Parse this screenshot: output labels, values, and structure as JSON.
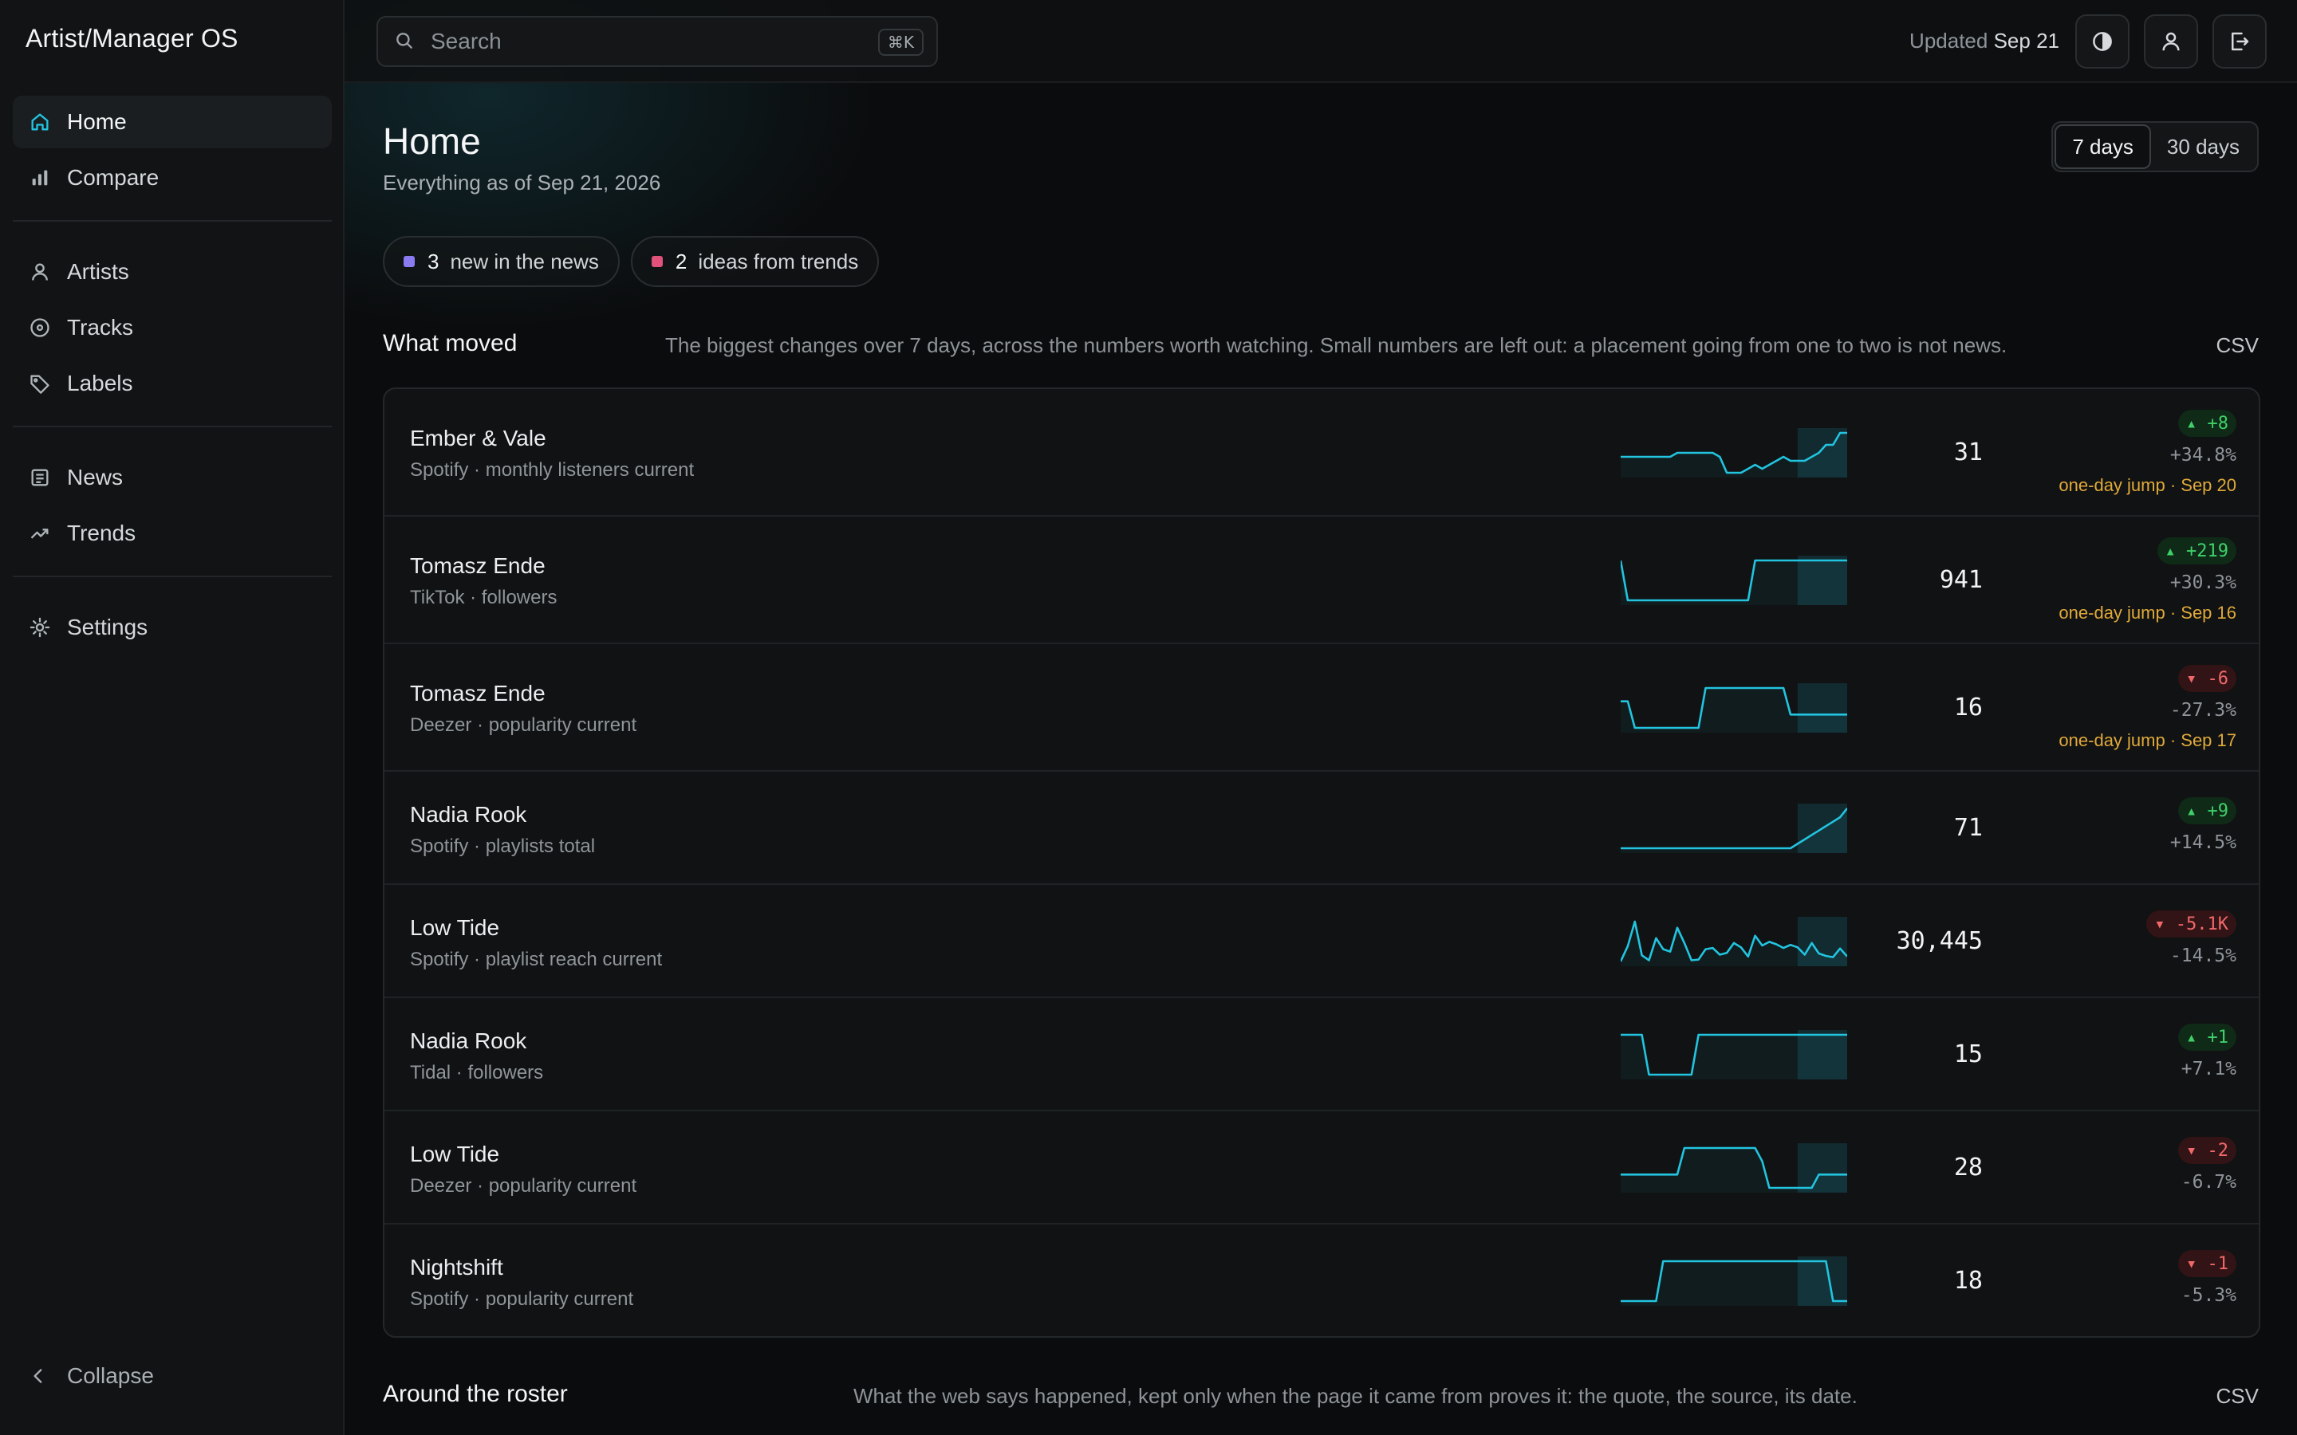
{
  "app": {
    "title": "Artist/Manager OS"
  },
  "sidebar": {
    "items": [
      {
        "label": "Home",
        "icon": "home-icon",
        "active": true
      },
      {
        "label": "Compare",
        "icon": "bar-chart-icon"
      },
      {
        "label": "Artists",
        "icon": "user-icon"
      },
      {
        "label": "Tracks",
        "icon": "disc-icon"
      },
      {
        "label": "Labels",
        "icon": "tag-icon"
      },
      {
        "label": "News",
        "icon": "newspaper-icon"
      },
      {
        "label": "Trends",
        "icon": "trending-up-icon"
      },
      {
        "label": "Settings",
        "icon": "gear-icon"
      }
    ],
    "collapse_label": "Collapse"
  },
  "topbar": {
    "search_placeholder": "Search",
    "search_shortcut": "⌘K",
    "updated_prefix": "Updated",
    "updated_date": "Sep 21"
  },
  "page": {
    "title": "Home",
    "subtitle": "Everything as of Sep 21, 2026",
    "range_options": [
      "7 days",
      "30 days"
    ],
    "range_selected": "7 days",
    "chips": [
      {
        "count": "3",
        "label": "new in the news",
        "color": "#8a7cf0"
      },
      {
        "count": "2",
        "label": "ideas from trends",
        "color": "#e0527a"
      }
    ]
  },
  "what_moved": {
    "title": "What moved",
    "description": "The biggest changes over 7 days, across the numbers worth watching. Small numbers are left out: a placement going from one to two is not news.",
    "csv_label": "CSV",
    "rows": [
      {
        "name": "Ember & Vale",
        "meta": "Spotify · monthly listeners current",
        "value": "31",
        "delta": "▴ +8",
        "direction": "up",
        "pct": "+34.8%",
        "jump": "one-day jump · Sep 20",
        "spark": [
          20,
          20,
          20,
          20,
          20,
          20,
          20,
          20,
          21,
          21,
          21,
          21,
          21,
          21,
          20,
          16,
          16,
          16,
          17,
          18,
          17,
          18,
          19,
          20,
          19,
          19,
          19,
          20,
          21,
          23,
          23,
          26,
          26
        ]
      },
      {
        "name": "Tomasz Ende",
        "meta": "TikTok · followers",
        "value": "941",
        "delta": "▴ +219",
        "direction": "up",
        "pct": "+30.3%",
        "jump": "one-day jump · Sep 16",
        "spark": [
          940,
          722,
          722,
          722,
          722,
          722,
          722,
          722,
          722,
          722,
          722,
          722,
          722,
          722,
          722,
          722,
          722,
          722,
          722,
          941,
          941,
          941,
          941,
          941,
          941,
          941,
          941,
          941,
          941,
          941,
          941,
          941,
          941
        ]
      },
      {
        "name": "Tomasz Ende",
        "meta": "Deezer · popularity current",
        "value": "16",
        "delta": "▾ -6",
        "direction": "down",
        "pct": "-27.3%",
        "jump": "one-day jump · Sep 17",
        "spark": [
          20,
          20,
          16,
          16,
          16,
          16,
          16,
          16,
          16,
          16,
          16,
          16,
          22,
          22,
          22,
          22,
          22,
          22,
          22,
          22,
          22,
          22,
          22,
          22,
          18,
          18,
          18,
          18,
          18,
          18,
          18,
          18,
          18
        ]
      },
      {
        "name": "Nadia Rook",
        "meta": "Spotify · playlists total",
        "value": "71",
        "delta": "▴ +9",
        "direction": "up",
        "pct": "+14.5%",
        "jump": "",
        "spark": [
          62,
          62,
          62,
          62,
          62,
          62,
          62,
          62,
          62,
          62,
          62,
          62,
          62,
          62,
          62,
          62,
          62,
          62,
          62,
          62,
          62,
          62,
          62,
          62,
          62,
          63,
          64,
          65,
          66,
          67,
          68,
          69,
          71
        ]
      },
      {
        "name": "Low Tide",
        "meta": "Spotify · playlist reach current",
        "value": "30,445",
        "delta": "▾ -5.1K",
        "direction": "down",
        "pct": "-14.5%",
        "jump": "",
        "spark": [
          31000,
          33500,
          37500,
          32000,
          31200,
          34800,
          33000,
          32600,
          36500,
          34000,
          31200,
          31300,
          33000,
          33200,
          32100,
          32400,
          34000,
          33300,
          31800,
          35200,
          33600,
          34200,
          33800,
          33200,
          33700,
          33300,
          32100,
          34000,
          32300,
          31900,
          31700,
          33100,
          31800
        ]
      },
      {
        "name": "Nadia Rook",
        "meta": "Tidal · followers",
        "value": "15",
        "delta": "▴ +1",
        "direction": "up",
        "pct": "+7.1%",
        "jump": "",
        "spark": [
          15,
          15,
          15,
          15,
          14,
          14,
          14,
          14,
          14,
          14,
          14,
          15,
          15,
          15,
          15,
          15,
          15,
          15,
          15,
          15,
          15,
          15,
          15,
          15,
          15,
          15,
          15,
          15,
          15,
          15,
          15,
          15,
          15
        ]
      },
      {
        "name": "Low Tide",
        "meta": "Deezer · popularity current",
        "value": "28",
        "delta": "▾ -2",
        "direction": "down",
        "pct": "-6.7%",
        "jump": "",
        "spark": [
          28,
          28,
          28,
          28,
          28,
          28,
          28,
          28,
          28,
          30,
          30,
          30,
          30,
          30,
          30,
          30,
          30,
          30,
          30,
          30,
          29,
          27,
          27,
          27,
          27,
          27,
          27,
          27,
          28,
          28,
          28,
          28,
          28
        ]
      },
      {
        "name": "Nightshift",
        "meta": "Spotify · popularity current",
        "value": "18",
        "delta": "▾ -1",
        "direction": "down",
        "pct": "-5.3%",
        "jump": "",
        "spark": [
          18,
          18,
          18,
          18,
          18,
          18,
          19,
          19,
          19,
          19,
          19,
          19,
          19,
          19,
          19,
          19,
          19,
          19,
          19,
          19,
          19,
          19,
          19,
          19,
          19,
          19,
          19,
          19,
          19,
          19,
          18,
          18,
          18
        ]
      }
    ]
  },
  "around_roster": {
    "title": "Around the roster",
    "description": "What the web says happened, kept only when the page it came from proves it: the quote, the source, its date.",
    "csv_label": "CSV"
  },
  "colors": {
    "accent": "#22c4e0",
    "up": "#3fd06a",
    "down": "#f0686a",
    "jump": "#e0a93a"
  }
}
